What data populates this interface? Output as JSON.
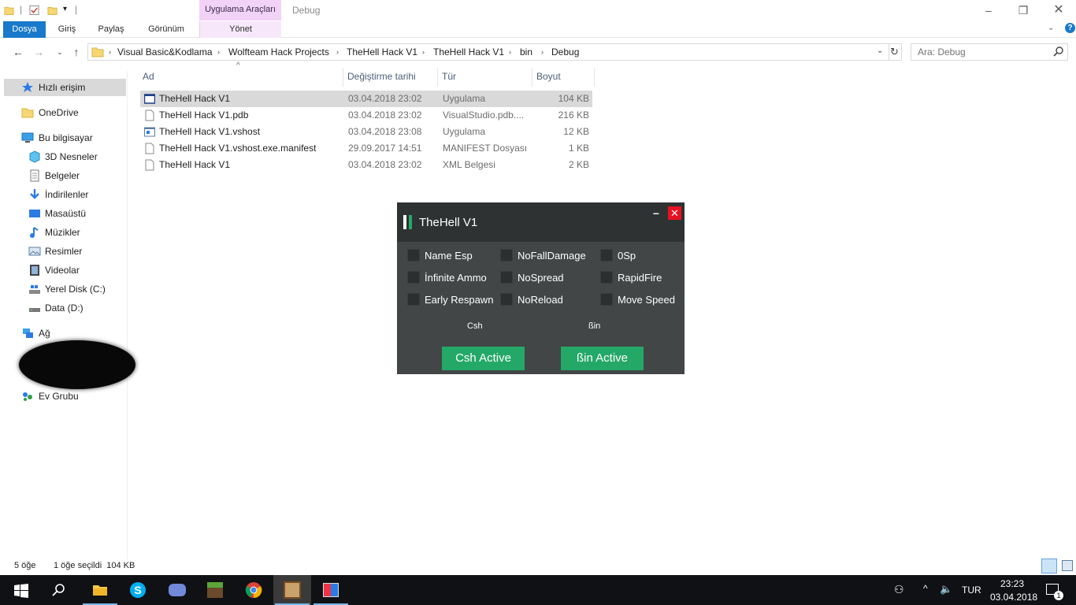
{
  "ribbon": {
    "context_group": "Uygulama Araçları",
    "context_tab": "Debug",
    "tabs": [
      "Dosya",
      "Giriş",
      "Paylaş",
      "Görünüm",
      "Yönet"
    ]
  },
  "address": {
    "crumbs": [
      "Visual Basic&Kodlama",
      "Wolfteam Hack Projects",
      "TheHell Hack V1",
      "TheHell Hack V1",
      "bin",
      "Debug"
    ],
    "search_placeholder": "Ara: Debug"
  },
  "sidebar": {
    "items": [
      {
        "label": "Hızlı erişim",
        "icon": "star-icon"
      },
      {
        "label": "OneDrive",
        "icon": "folder-icon"
      },
      {
        "label": "Bu bilgisayar",
        "icon": "computer-icon"
      },
      {
        "label": "3D Nesneler",
        "icon": "cube-icon"
      },
      {
        "label": "Belgeler",
        "icon": "document-icon"
      },
      {
        "label": "İndirilenler",
        "icon": "download-icon"
      },
      {
        "label": "Masaüstü",
        "icon": "desktop-icon"
      },
      {
        "label": "Müzikler",
        "icon": "music-icon"
      },
      {
        "label": "Resimler",
        "icon": "picture-icon"
      },
      {
        "label": "Videolar",
        "icon": "video-icon"
      },
      {
        "label": "Yerel Disk (C:)",
        "icon": "drive-icon"
      },
      {
        "label": "Data (D:)",
        "icon": "drive-icon"
      },
      {
        "label": "Ağ",
        "icon": "network-icon"
      },
      {
        "label": "Ev Grubu",
        "icon": "homegroup-icon"
      }
    ]
  },
  "files": {
    "columns": [
      "Ad",
      "Değiştirme tarihi",
      "Tür",
      "Boyut"
    ],
    "rows": [
      {
        "name": "TheHell Hack V1",
        "date": "03.04.2018 23:02",
        "type": "Uygulama",
        "size": "104 KB",
        "icon": "application-icon",
        "selected": true
      },
      {
        "name": "TheHell Hack V1.pdb",
        "date": "03.04.2018 23:02",
        "type": "VisualStudio.pdb....",
        "size": "216 KB",
        "icon": "file-icon",
        "selected": false
      },
      {
        "name": "TheHell Hack V1.vshost",
        "date": "03.04.2018 23:08",
        "type": "Uygulama",
        "size": "12 KB",
        "icon": "application-icon",
        "selected": false
      },
      {
        "name": "TheHell Hack V1.vshost.exe.manifest",
        "date": "29.09.2017 14:51",
        "type": "MANIFEST Dosyası",
        "size": "1 KB",
        "icon": "file-icon",
        "selected": false
      },
      {
        "name": "TheHell Hack V1",
        "date": "03.04.2018 23:02",
        "type": "XML Belgesi",
        "size": "2 KB",
        "icon": "file-icon",
        "selected": false
      }
    ]
  },
  "hack": {
    "title": "TheHell V1",
    "options": [
      [
        "Name Esp",
        "NoFallDamage",
        "0Sp"
      ],
      [
        "İnfinite Ammo",
        "NoSpread",
        "RapidFire"
      ],
      [
        "Early Respawn",
        "NoReload",
        "Move Speed"
      ]
    ],
    "csh_label": "Csh",
    "bin_label": "ßin",
    "csh_button": "Csh Active",
    "bin_button": "ßin Active",
    "accent": "#24a868",
    "close_color": "#e81123"
  },
  "status": {
    "count": "5 öğe",
    "selection": "1 öğe seçildi  104 KB"
  },
  "taskbar": {
    "language": "TUR",
    "time": "23:23",
    "date": "03.04.2018",
    "notification_count": "1"
  }
}
